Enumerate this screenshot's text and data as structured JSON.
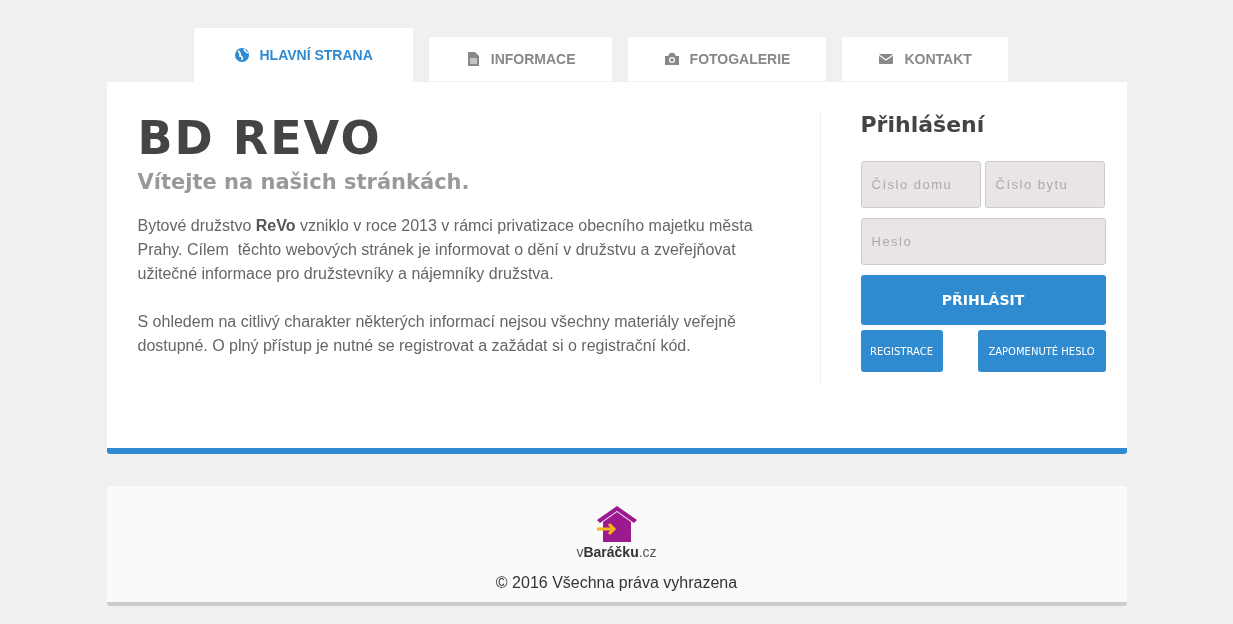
{
  "tabs": [
    {
      "label": "HLAVNÍ STRANA",
      "kind": "globe",
      "selected": true
    },
    {
      "label": "INFORMACE",
      "kind": "document",
      "selected": false
    },
    {
      "label": "FOTOGALERIE",
      "kind": "camera",
      "selected": false
    },
    {
      "label": "KONTAKT",
      "kind": "envelope",
      "selected": false
    }
  ],
  "main": {
    "title": "BD REVO",
    "subtitle": "Vítejte na našich stránkách.",
    "paragraphs": [
      "Bytové družstvo **ReVo** vzniklo v roce 2013 v rámci privatizace obecního majetku města Prahy. Cílem  těchto webových stránek je informovat o dění v družstvu a zveřejňovat užitečné informace pro družstevníky a nájemníky družstva.",
      "S ohledem na citlivý charakter některých informací nejsou všechny materiály veřejně dostupné. O plný přístup je nutné se registrovat a zažádat si o registrační kód."
    ]
  },
  "login": {
    "title": "Přihlášení",
    "house_field": {
      "placeholder": "Číslo domu"
    },
    "flat_field": {
      "placeholder": "Číslo bytu"
    },
    "password_field": {
      "placeholder": "Heslo"
    },
    "submit": "PŘIHLÁSIT",
    "register": "REGISTRACE",
    "forgot": "ZAPOMENUTÉ HESLO"
  },
  "footer": {
    "logo_text": "v**Baráčku**.cz",
    "copyright": "© 2016 Všechna práva vyhrazena"
  }
}
